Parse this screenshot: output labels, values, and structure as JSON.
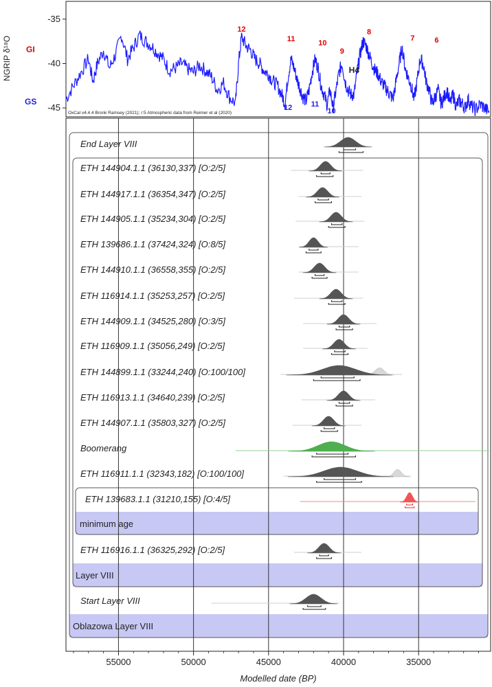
{
  "chart_data": [
    {
      "type": "line",
      "ylabel": "NGRIP δ¹⁸O",
      "y_ticks": [
        -35,
        -40,
        -45
      ],
      "ylim": [
        -46,
        -33
      ],
      "xlim": [
        58500,
        30200
      ],
      "series_color": "#1a1aff",
      "gi_label": "GI",
      "gs_label": "GS",
      "credit": "OxCal v4.4.4 Bronk Ramsey (2021); r:5 Atmospheric data from Reimer et al (2020)",
      "series": [
        {
          "name": "NGRIP",
          "x": [
            58500,
            58000,
            57500,
            57000,
            56700,
            56400,
            56000,
            55600,
            55200,
            54800,
            54400,
            54000,
            53600,
            53200,
            52800,
            52400,
            52000,
            51600,
            51200,
            50800,
            50400,
            50000,
            49600,
            49200,
            48800,
            48400,
            48000,
            47600,
            47200,
            47000,
            46800,
            46500,
            46200,
            45900,
            45600,
            45300,
            45000,
            44700,
            44400,
            44100,
            43900,
            43700,
            43500,
            43300,
            43100,
            42900,
            42700,
            42500,
            42300,
            42100,
            41900,
            41700,
            41500,
            41300,
            41100,
            40900,
            40700,
            40500,
            40300,
            40100,
            39900,
            39700,
            39500,
            39300,
            39100,
            38900,
            38700,
            38500,
            38300,
            38100,
            37900,
            37700,
            37500,
            37300,
            37100,
            36900,
            36700,
            36500,
            36300,
            36100,
            35900,
            35700,
            35500,
            35300,
            35100,
            34900,
            34700,
            34500,
            34300,
            34100,
            33900,
            33700,
            33500,
            33300,
            33100,
            32900,
            32700,
            32500,
            32300,
            32100,
            31900,
            31700,
            31500,
            31200,
            30900,
            30600,
            30300
          ],
          "values": [
            -44.0,
            -42.5,
            -41.0,
            -39.5,
            -42.0,
            -40.0,
            -38.5,
            -40.5,
            -39.0,
            -36.8,
            -39.5,
            -38.2,
            -36.8,
            -37.5,
            -38.0,
            -38.8,
            -39.5,
            -40.8,
            -40.5,
            -40.0,
            -40.6,
            -41.0,
            -40.2,
            -40.8,
            -41.5,
            -43.0,
            -42.2,
            -43.8,
            -44.5,
            -40.0,
            -37.0,
            -38.0,
            -38.5,
            -39.5,
            -40.0,
            -40.8,
            -41.2,
            -42.0,
            -42.5,
            -43.6,
            -44.5,
            -41.5,
            -39.5,
            -40.5,
            -41.8,
            -42.8,
            -43.8,
            -44.2,
            -43.0,
            -41.0,
            -39.5,
            -40.5,
            -42.5,
            -43.5,
            -44.6,
            -43.0,
            -45.0,
            -43.0,
            -41.0,
            -40.0,
            -42.0,
            -43.0,
            -43.5,
            -43.5,
            -41.0,
            -39.0,
            -37.5,
            -38.0,
            -39.0,
            -40.0,
            -40.8,
            -41.2,
            -42.0,
            -42.5,
            -43.0,
            -43.5,
            -44.0,
            -42.0,
            -40.0,
            -38.2,
            -40.5,
            -41.5,
            -42.5,
            -44.0,
            -42.0,
            -39.5,
            -40.0,
            -42.0,
            -43.0,
            -44.5,
            -43.8,
            -43.0,
            -44.5,
            -43.8,
            -43.0,
            -44.5,
            -43.5,
            -44.8,
            -44.2,
            -44.5,
            -45.0,
            -44.0,
            -44.8,
            -45.2,
            -44.6,
            -45.0,
            -45.5
          ]
        }
      ],
      "annotations": [
        {
          "text": "12",
          "x": 46800,
          "kind": "GI"
        },
        {
          "text": "11",
          "x": 43500,
          "kind": "GI"
        },
        {
          "text": "10",
          "x": 41400,
          "kind": "GI"
        },
        {
          "text": "9",
          "x": 40100,
          "kind": "GI"
        },
        {
          "text": "8",
          "x": 38300,
          "kind": "GI"
        },
        {
          "text": "7",
          "x": 35400,
          "kind": "GI"
        },
        {
          "text": "6",
          "x": 33800,
          "kind": "GI"
        },
        {
          "text": "12",
          "x": 43700,
          "kind": "GS"
        },
        {
          "text": "11",
          "x": 41900,
          "kind": "GS"
        },
        {
          "text": "10",
          "x": 40800,
          "kind": "GS"
        },
        {
          "text": "H4",
          "x": 39300,
          "kind": "H"
        }
      ]
    },
    {
      "type": "area",
      "xlabel": "Modelled date (BP)",
      "xlim": [
        58500,
        30200
      ],
      "x_ticks": [
        55000,
        50000,
        45000,
        40000,
        35000
      ],
      "x_tick_labels": [
        "55000",
        "50000",
        "45000",
        "40000",
        "35000"
      ],
      "vlines": [
        55000,
        50000,
        45000,
        40000,
        35000
      ],
      "boxes": [
        {
          "name": "Oblazowa Layer VIII"
        },
        {
          "name": "Layer VIII"
        },
        {
          "name": "minimum age"
        }
      ],
      "rows": [
        {
          "label": "End Layer VIII",
          "style": "boundary",
          "mode": 39700,
          "spread": 500,
          "uncert_min": 40300,
          "uncert_max": 38600,
          "r1": [
            40000,
            39200
          ],
          "r2": [
            40300,
            38700
          ]
        },
        {
          "label": "ETH 144904.1.1 (36130,337) [O:2/5]",
          "style": "date",
          "mode": 41200,
          "spread": 350,
          "uncert_min": 43500,
          "uncert_max": 38700,
          "r1": [
            41500,
            40900
          ],
          "r2": [
            41800,
            40700
          ]
        },
        {
          "label": "ETH 144917.1.1 (36354,347) [O:2/5]",
          "style": "date",
          "mode": 41400,
          "spread": 350,
          "uncert_min": 43000,
          "uncert_max": 38800,
          "r1": [
            41700,
            41000
          ],
          "r2": [
            41900,
            40800
          ]
        },
        {
          "label": "ETH 144905.1.1 (35234,304) [O:2/5]",
          "style": "date",
          "mode": 40500,
          "spread": 350,
          "uncert_min": 43200,
          "uncert_max": 38600,
          "r1": [
            40800,
            40100
          ],
          "r2": [
            41000,
            39900
          ]
        },
        {
          "label": "ETH 139686.1.1 (37424,324) [O:8/5]",
          "style": "date",
          "mode": 42000,
          "spread": 300,
          "uncert_min": 43000,
          "uncert_max": 39000,
          "r1": [
            42300,
            41700
          ],
          "r2": [
            42500,
            41500
          ]
        },
        {
          "label": "ETH 144910.1.1 (36558,355) [O:2/5]",
          "style": "date",
          "mode": 41600,
          "spread": 350,
          "uncert_min": 43000,
          "uncert_max": 39000,
          "r1": [
            41900,
            41300
          ],
          "r2": [
            42100,
            41100
          ]
        },
        {
          "label": "ETH 116914.1.1 (35253,257) [O:2/5]",
          "style": "date",
          "mode": 40500,
          "spread": 350,
          "uncert_min": 43300,
          "uncert_max": 38700,
          "r1": [
            40800,
            40100
          ],
          "r2": [
            41000,
            39900
          ]
        },
        {
          "label": "ETH 144909.1.1 (34525,280) [O:3/5]",
          "style": "date",
          "mode": 40000,
          "spread": 350,
          "uncert_min": 42700,
          "uncert_max": 37800,
          "r1": [
            40300,
            39600
          ],
          "r2": [
            40500,
            39400
          ]
        },
        {
          "label": "ETH 116909.1.1 (35056,249) [O:2/5]",
          "style": "date",
          "mode": 40300,
          "spread": 350,
          "uncert_min": 42700,
          "uncert_max": 38400,
          "r1": [
            40600,
            39900
          ],
          "r2": [
            40800,
            39700
          ]
        },
        {
          "label": "ETH 144899.1.1 (33244,240) [O:100/100]",
          "style": "date-outlier",
          "mode": 40300,
          "spread": 1100,
          "uncert_min": 44200,
          "uncert_max": 36100,
          "r1": [
            41500,
            39300
          ],
          "r2": [
            42000,
            38900
          ],
          "prior_mode": 37600,
          "prior_spread": 300
        },
        {
          "label": "ETH 116913.1.1 (34640,239) [O:2/5]",
          "style": "date",
          "mode": 40000,
          "spread": 350,
          "uncert_min": 42800,
          "uncert_max": 37900,
          "r1": [
            40300,
            39600
          ],
          "r2": [
            40500,
            39400
          ]
        },
        {
          "label": "ETH 144907.1.1 (35803,327) [O:2/5]",
          "style": "date",
          "mode": 41000,
          "spread": 350,
          "uncert_min": 43400,
          "uncert_max": 38800,
          "r1": [
            41300,
            40600
          ],
          "r2": [
            41500,
            40400
          ]
        },
        {
          "label": "Boomerang",
          "style": "summary",
          "mode": 40800,
          "spread": 900,
          "uncert_min": 47200,
          "uncert_max": 30300,
          "r1": [
            41800,
            39700
          ],
          "r2": [
            42100,
            39200
          ]
        },
        {
          "label": "ETH 116911.1.1 (32343,182) [O:100/100]",
          "style": "date-outlier",
          "mode": 40200,
          "spread": 1100,
          "uncert_min": 44000,
          "uncert_max": 35500,
          "r1": [
            41300,
            39200
          ],
          "r2": [
            41800,
            38800
          ],
          "prior_mode": 36400,
          "prior_spread": 250
        },
        {
          "label": "ETH 139683.1.1 (31210,155) [O:4/5]",
          "style": "minimum",
          "mode": 35600,
          "spread": 200,
          "uncert_min": 42900,
          "uncert_max": 31200,
          "r1": [
            35800,
            35400
          ],
          "r2": [
            35900,
            35300
          ]
        },
        {
          "label": "ETH 116916.1.1 (36325,292) [O:2/5]",
          "style": "date",
          "mode": 41300,
          "spread": 350,
          "uncert_min": 43300,
          "uncert_max": 38800,
          "r1": [
            41600,
            41000
          ],
          "r2": [
            41800,
            40800
          ]
        },
        {
          "label": "Start Layer VIII",
          "style": "boundary",
          "mode": 42000,
          "spread": 500,
          "uncert_min": 48800,
          "uncert_max": 40300,
          "r1": [
            42400,
            41500
          ],
          "r2": [
            42700,
            41200
          ]
        }
      ]
    }
  ]
}
